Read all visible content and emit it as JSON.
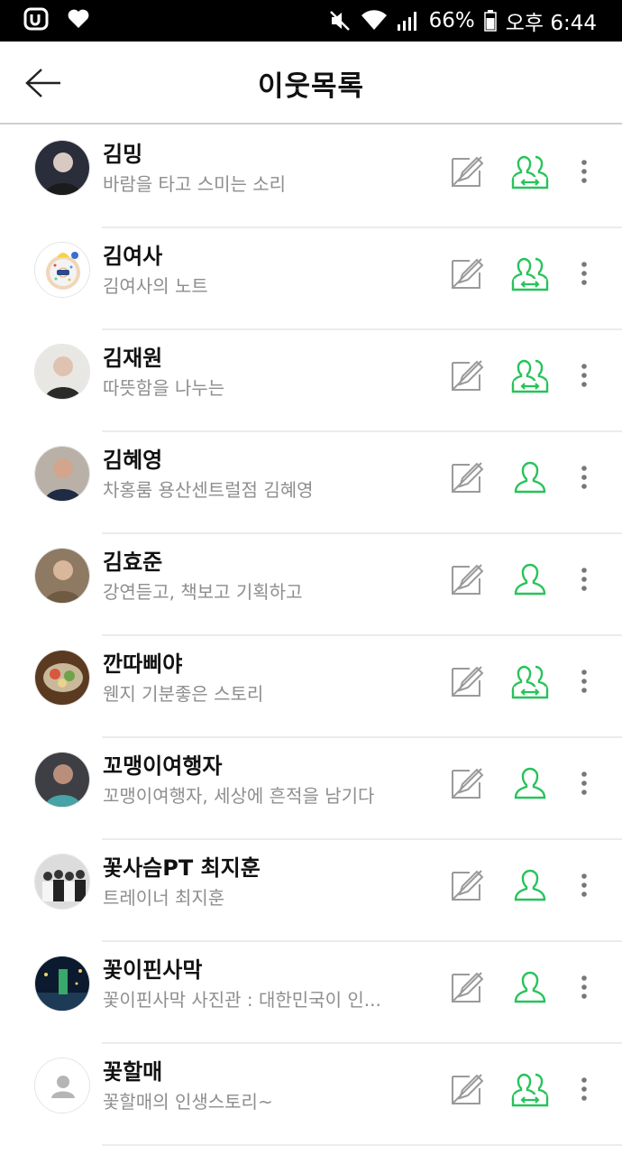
{
  "status_bar": {
    "battery_percent": "66%",
    "time": "오후 6:44",
    "icons": [
      "uplus-icon",
      "heart-icon",
      "mute-icon",
      "wifi-icon",
      "signal-icon",
      "battery-icon"
    ]
  },
  "header": {
    "title": "이웃목록",
    "back_icon": "arrow-left-icon"
  },
  "colors": {
    "accent_green": "#27c35a",
    "icon_gray": "#9a9a9a",
    "divider": "#ececec"
  },
  "neighbors": [
    {
      "name": "김밍",
      "desc": "바람을 타고 스미는 소리",
      "relation": "mutual",
      "avatar_icon": "photo-avatar"
    },
    {
      "name": "김여사",
      "desc": "김여사의 노트",
      "relation": "mutual",
      "avatar_icon": "donut-avatar"
    },
    {
      "name": "김재원",
      "desc": "따뜻함을 나누는",
      "relation": "mutual",
      "avatar_icon": "photo-avatar"
    },
    {
      "name": "김혜영",
      "desc": "차홍룸 용산센트럴점 김혜영",
      "relation": "single",
      "avatar_icon": "photo-avatar"
    },
    {
      "name": "김효준",
      "desc": "강연듣고, 책보고 기획하고",
      "relation": "single",
      "avatar_icon": "photo-avatar"
    },
    {
      "name": "깐따삐야",
      "desc": "웬지 기분좋은 스토리",
      "relation": "mutual",
      "avatar_icon": "food-avatar"
    },
    {
      "name": "꼬맹이여행자",
      "desc": "꼬맹이여행자, 세상에 흔적을 남기다",
      "relation": "single",
      "avatar_icon": "photo-avatar"
    },
    {
      "name": "꽃사슴PT 최지훈",
      "desc": "트레이너 최지훈",
      "relation": "single",
      "avatar_icon": "group-photo-avatar"
    },
    {
      "name": "꽃이핀사막",
      "desc": "꽃이핀사막 사진관 : 대한민국이 인...",
      "relation": "single",
      "avatar_icon": "night-photo-avatar"
    },
    {
      "name": "꽃할매",
      "desc": "꽃할매의 인생스토리~",
      "relation": "mutual",
      "avatar_icon": "default-avatar"
    }
  ]
}
